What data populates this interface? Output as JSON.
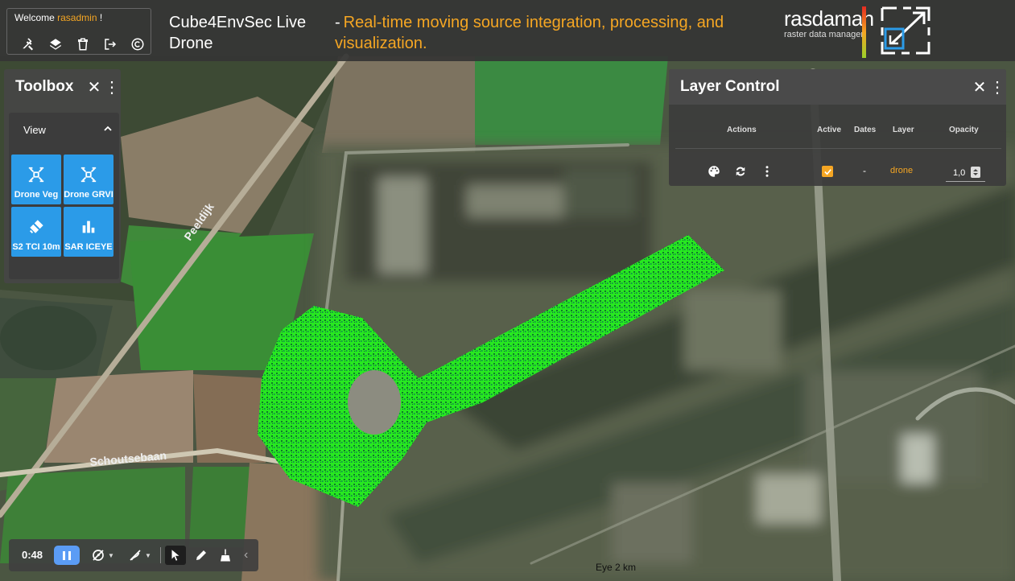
{
  "header": {
    "welcome_prefix": "Welcome",
    "username": "rasadmin",
    "welcome_suffix": "!",
    "title": "Cube4EnvSec Live Drone",
    "subtitle_dash": "-",
    "subtitle": "Real-time moving source integration, processing, and visualization.",
    "logo_name": "rasdaman",
    "logo_tagline": "raster data manager",
    "icons": [
      "tools-icon",
      "layers-icon",
      "trash-icon",
      "logout-icon",
      "copyright-icon"
    ]
  },
  "toolbox": {
    "title": "Toolbox",
    "close": "✕",
    "menu": "⋮",
    "section_label": "View",
    "buttons": [
      {
        "label": "Drone Veg",
        "icon": "drone-icon"
      },
      {
        "label": "Drone GRVI",
        "icon": "drone-icon"
      },
      {
        "label": "S2 TCI 10m",
        "icon": "satellite-icon"
      },
      {
        "label": "SAR ICEYE",
        "icon": "bar-chart-icon"
      }
    ]
  },
  "layer_control": {
    "title": "Layer Control",
    "close": "✕",
    "menu": "⋮",
    "columns": [
      "Actions",
      "Active",
      "Dates",
      "Layer",
      "Opacity"
    ],
    "row": {
      "active": true,
      "dates": "-",
      "layer": "drone",
      "opacity": "1,0"
    }
  },
  "bottom_bar": {
    "time": "0:48",
    "chevron": "‹"
  },
  "map": {
    "road_1": "Peeldijk",
    "road_2": "Schoutsebaan",
    "eye_label": "Eye",
    "eye_value": "2 km"
  },
  "colors": {
    "accent": "#f5a623",
    "button_blue": "#2b9be8",
    "pause_blue": "#5b9cf5",
    "drone_green": "#1fe80f"
  }
}
